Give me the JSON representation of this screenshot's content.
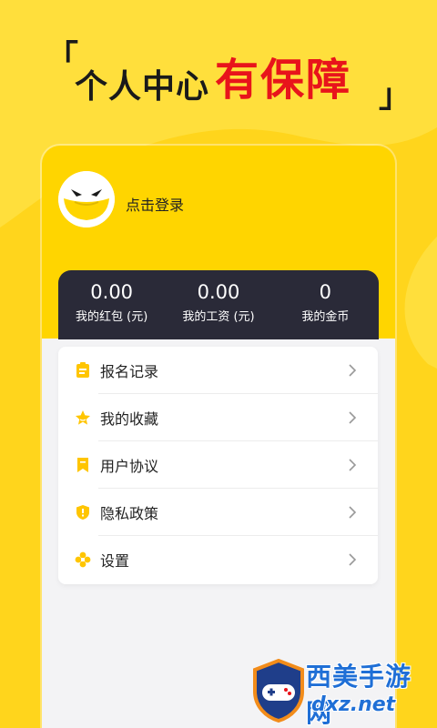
{
  "headline": {
    "bracket_open": "「",
    "text_black": "个人中心",
    "text_red": "有保障",
    "bracket_close": "」"
  },
  "profile": {
    "avatar_icon": "mascot-face-icon",
    "login_label": "点击登录"
  },
  "stats": [
    {
      "value": "0.00",
      "label": "我的红包 (元)"
    },
    {
      "value": "0.00",
      "label": "我的工资 (元)"
    },
    {
      "value": "0",
      "label": "我的金币"
    }
  ],
  "menu": [
    {
      "label": "报名记录",
      "icon": "clipboard-icon"
    },
    {
      "label": "我的收藏",
      "icon": "star-icon"
    },
    {
      "label": "用户协议",
      "icon": "bookmark-icon"
    },
    {
      "label": "隐私政策",
      "icon": "shield-icon"
    },
    {
      "label": "设置",
      "icon": "settings-icon"
    }
  ],
  "watermark": {
    "line1": "西美手游网",
    "line2": "dxz.net"
  },
  "colors": {
    "brand_yellow": "#FFD51C",
    "headline_red": "#E8141B",
    "stats_dark": "#2A2A38",
    "watermark_blue": "#1F6FD6"
  }
}
